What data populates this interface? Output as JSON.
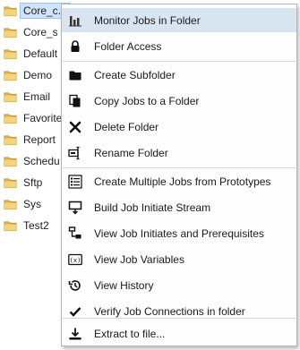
{
  "tree": {
    "items": [
      {
        "label": "Core_c...",
        "selected": true
      },
      {
        "label": "Core_s"
      },
      {
        "label": "Default"
      },
      {
        "label": "Demo"
      },
      {
        "label": "Email"
      },
      {
        "label": "Favorite"
      },
      {
        "label": "Report"
      },
      {
        "label": "Schedu"
      },
      {
        "label": "Sftp"
      },
      {
        "label": "Sys"
      },
      {
        "label": "Test2"
      }
    ]
  },
  "context_menu": {
    "items": [
      {
        "label": "Monitor Jobs in Folder",
        "icon": "bar-chart-icon",
        "hover": true
      },
      {
        "label": "Folder Access",
        "icon": "lock-icon"
      },
      {
        "label": "Create Subfolder",
        "icon": "folder-icon"
      },
      {
        "label": "Copy Jobs to a Folder",
        "icon": "copy-icon"
      },
      {
        "label": "Delete Folder",
        "icon": "x-icon"
      },
      {
        "label": "Rename Folder",
        "icon": "rename-icon"
      },
      {
        "label": "Create Multiple Jobs from Prototypes",
        "icon": "list-icon"
      },
      {
        "label": "Build Job Initiate Stream",
        "icon": "stream-icon"
      },
      {
        "label": "View Job Initiates and Prerequisites",
        "icon": "hierarchy-icon"
      },
      {
        "label": "View Job Variables",
        "icon": "variable-icon"
      },
      {
        "label": "View History",
        "icon": "history-icon"
      },
      {
        "label": "Verify Job Connections in folder",
        "icon": "check-icon"
      },
      {
        "label": "Extract to file...",
        "icon": "download-icon"
      }
    ]
  },
  "colors": {
    "hover": "#d9e4f1",
    "folder": "#e8b54a",
    "selection": "#cde4fb"
  }
}
